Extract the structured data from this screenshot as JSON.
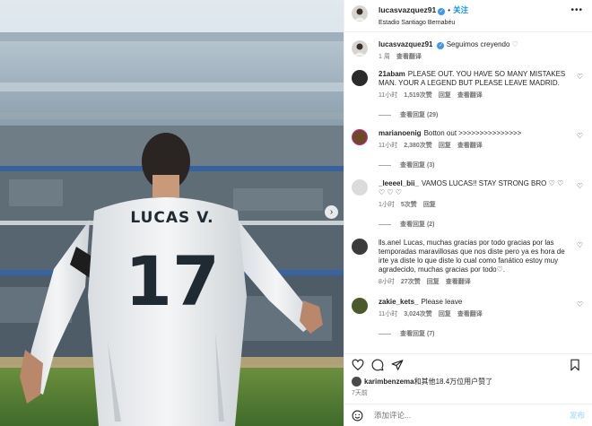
{
  "post": {
    "username": "lucasvazquez91",
    "follow_label": "关注",
    "location": "Estadio Santiago Bernabéu",
    "caption": "Seguimos creyendo",
    "caption_time": "1 周",
    "caption_translate": "查看翻译"
  },
  "photo": {
    "jersey_name": "LUCAS V.",
    "jersey_number": "17"
  },
  "comments": [
    {
      "user": "21abam",
      "text": "PLEASE OUT. YOU HAVE SO MANY MISTAKES MAN. YOUR A LEGEND BUT PLEASE LEAVE MADRID.",
      "time": "11小时",
      "likes": "1,519次赞",
      "reply": "回复",
      "translate": "查看翻译",
      "replies": "查看回复 (29)",
      "avatar_color": "#2b2b2b"
    },
    {
      "user": "marianoenig",
      "text": "Botton out >>>>>>>>>>>>>>>",
      "time": "11小时",
      "likes": "2,380次赞",
      "reply": "回复",
      "translate": "查看翻译",
      "replies": "查看回复 (3)",
      "avatar_color": "#6b4a2a"
    },
    {
      "user": "_leeeel_bii_",
      "text": "VAMOS LUCAS!! STAY STRONG BRO ♡ ♡ ♡ ♡ ♡",
      "time": "1小时",
      "likes": "5次赞",
      "reply": "回复",
      "translate": "",
      "replies": "查看回复 (2)",
      "avatar_color": "#dbdbdb"
    },
    {
      "user": "lls.anel",
      "text": "Lucas, muchas gracias por todo gracias por las temporadas maravillosas que nos diste pero ya es hora de irte ya diste lo que diste lo cual como fanático estoy muy agradecido, muchas gracias por todo♡.",
      "time": "8小时",
      "likes": "27次赞",
      "reply": "回复",
      "translate": "查看翻译",
      "replies": "",
      "avatar_color": "#3b3b3b"
    },
    {
      "user": "zakie_kets_",
      "text": "Please leave",
      "time": "11小时",
      "likes": "3,024次赞",
      "reply": "回复",
      "translate": "查看翻译",
      "replies": "查看回复 (7)",
      "avatar_color": "#4a5a2a"
    }
  ],
  "likes_line": {
    "user": "karimbenzema",
    "rest": "和其他18.4万位用户赞了"
  },
  "post_age": "7天前",
  "add_comment": {
    "placeholder": "添加评论...",
    "post_label": "发布"
  },
  "colors": {
    "accent": "#0095f6",
    "muted": "#737373",
    "verified": "#3897f0"
  },
  "icons": [
    "more-icon",
    "heart-icon",
    "comment-icon",
    "share-icon",
    "bookmark-icon",
    "emoji-icon",
    "chevron-right-icon",
    "verified-icon"
  ]
}
